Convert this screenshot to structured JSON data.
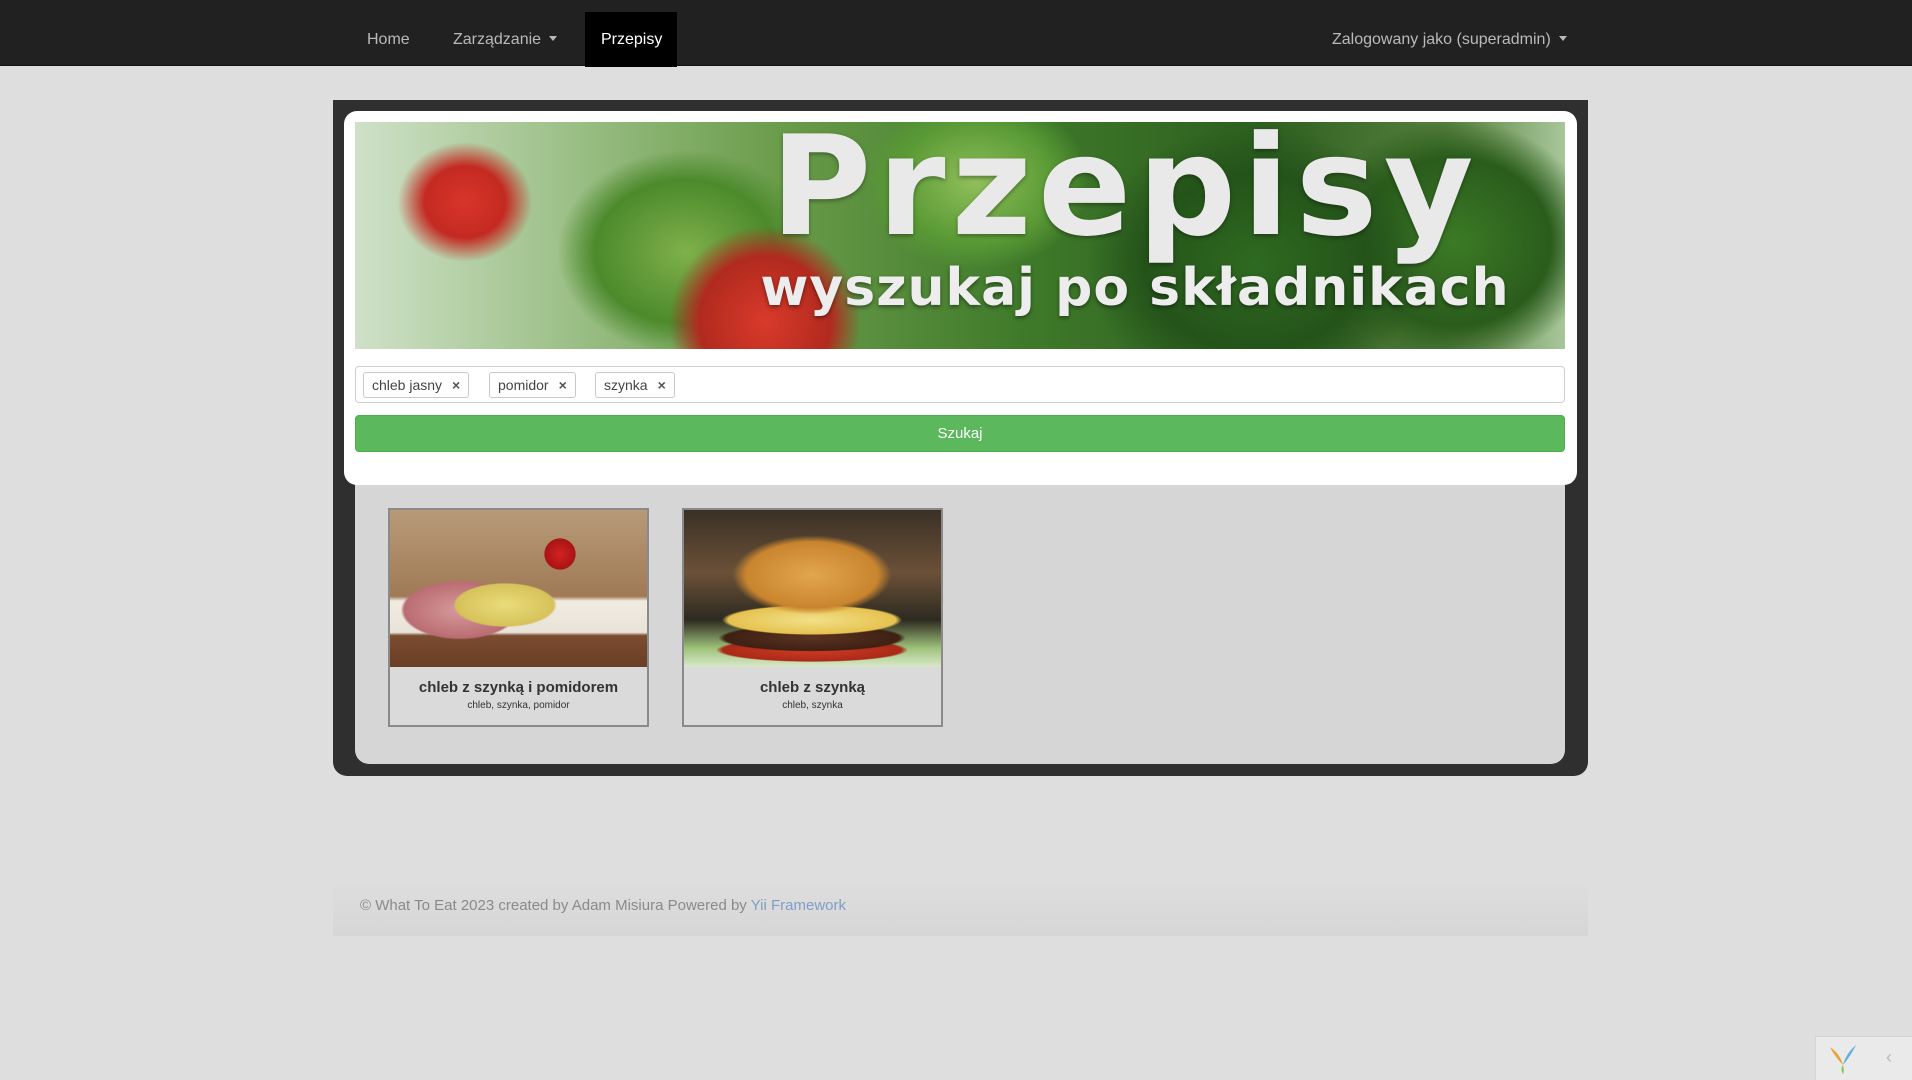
{
  "navbar": {
    "home": "Home",
    "management": "Zarządzanie",
    "recipes": "Przepisy",
    "user": "Zalogowany jako (superadmin)"
  },
  "banner": {
    "title": "Przepisy",
    "subtitle": "wyszukaj po składnikach"
  },
  "search": {
    "tags": [
      {
        "label": "chleb jasny"
      },
      {
        "label": "pomidor"
      },
      {
        "label": "szynka"
      }
    ],
    "remove_glyph": "×",
    "button_label": "Szukaj"
  },
  "recipes": [
    {
      "title": "chleb z szynką i pomidorem",
      "ingredients": "chleb, szynka, pomidor"
    },
    {
      "title": "chleb z szynką",
      "ingredients": "chleb, szynka"
    }
  ],
  "footer": {
    "text": "© What To Eat 2023 created by Adam Misiura Powered by ",
    "link": "Yii Framework"
  },
  "colors": {
    "navbar_bg": "#212121",
    "search_button": "#5cb85c",
    "footer_link": "#7f9ec7"
  },
  "icons": {
    "tag_remove": "close-icon",
    "debug_logo": "yii-logo-icon",
    "debug_toggle": "chevron-left-icon"
  }
}
